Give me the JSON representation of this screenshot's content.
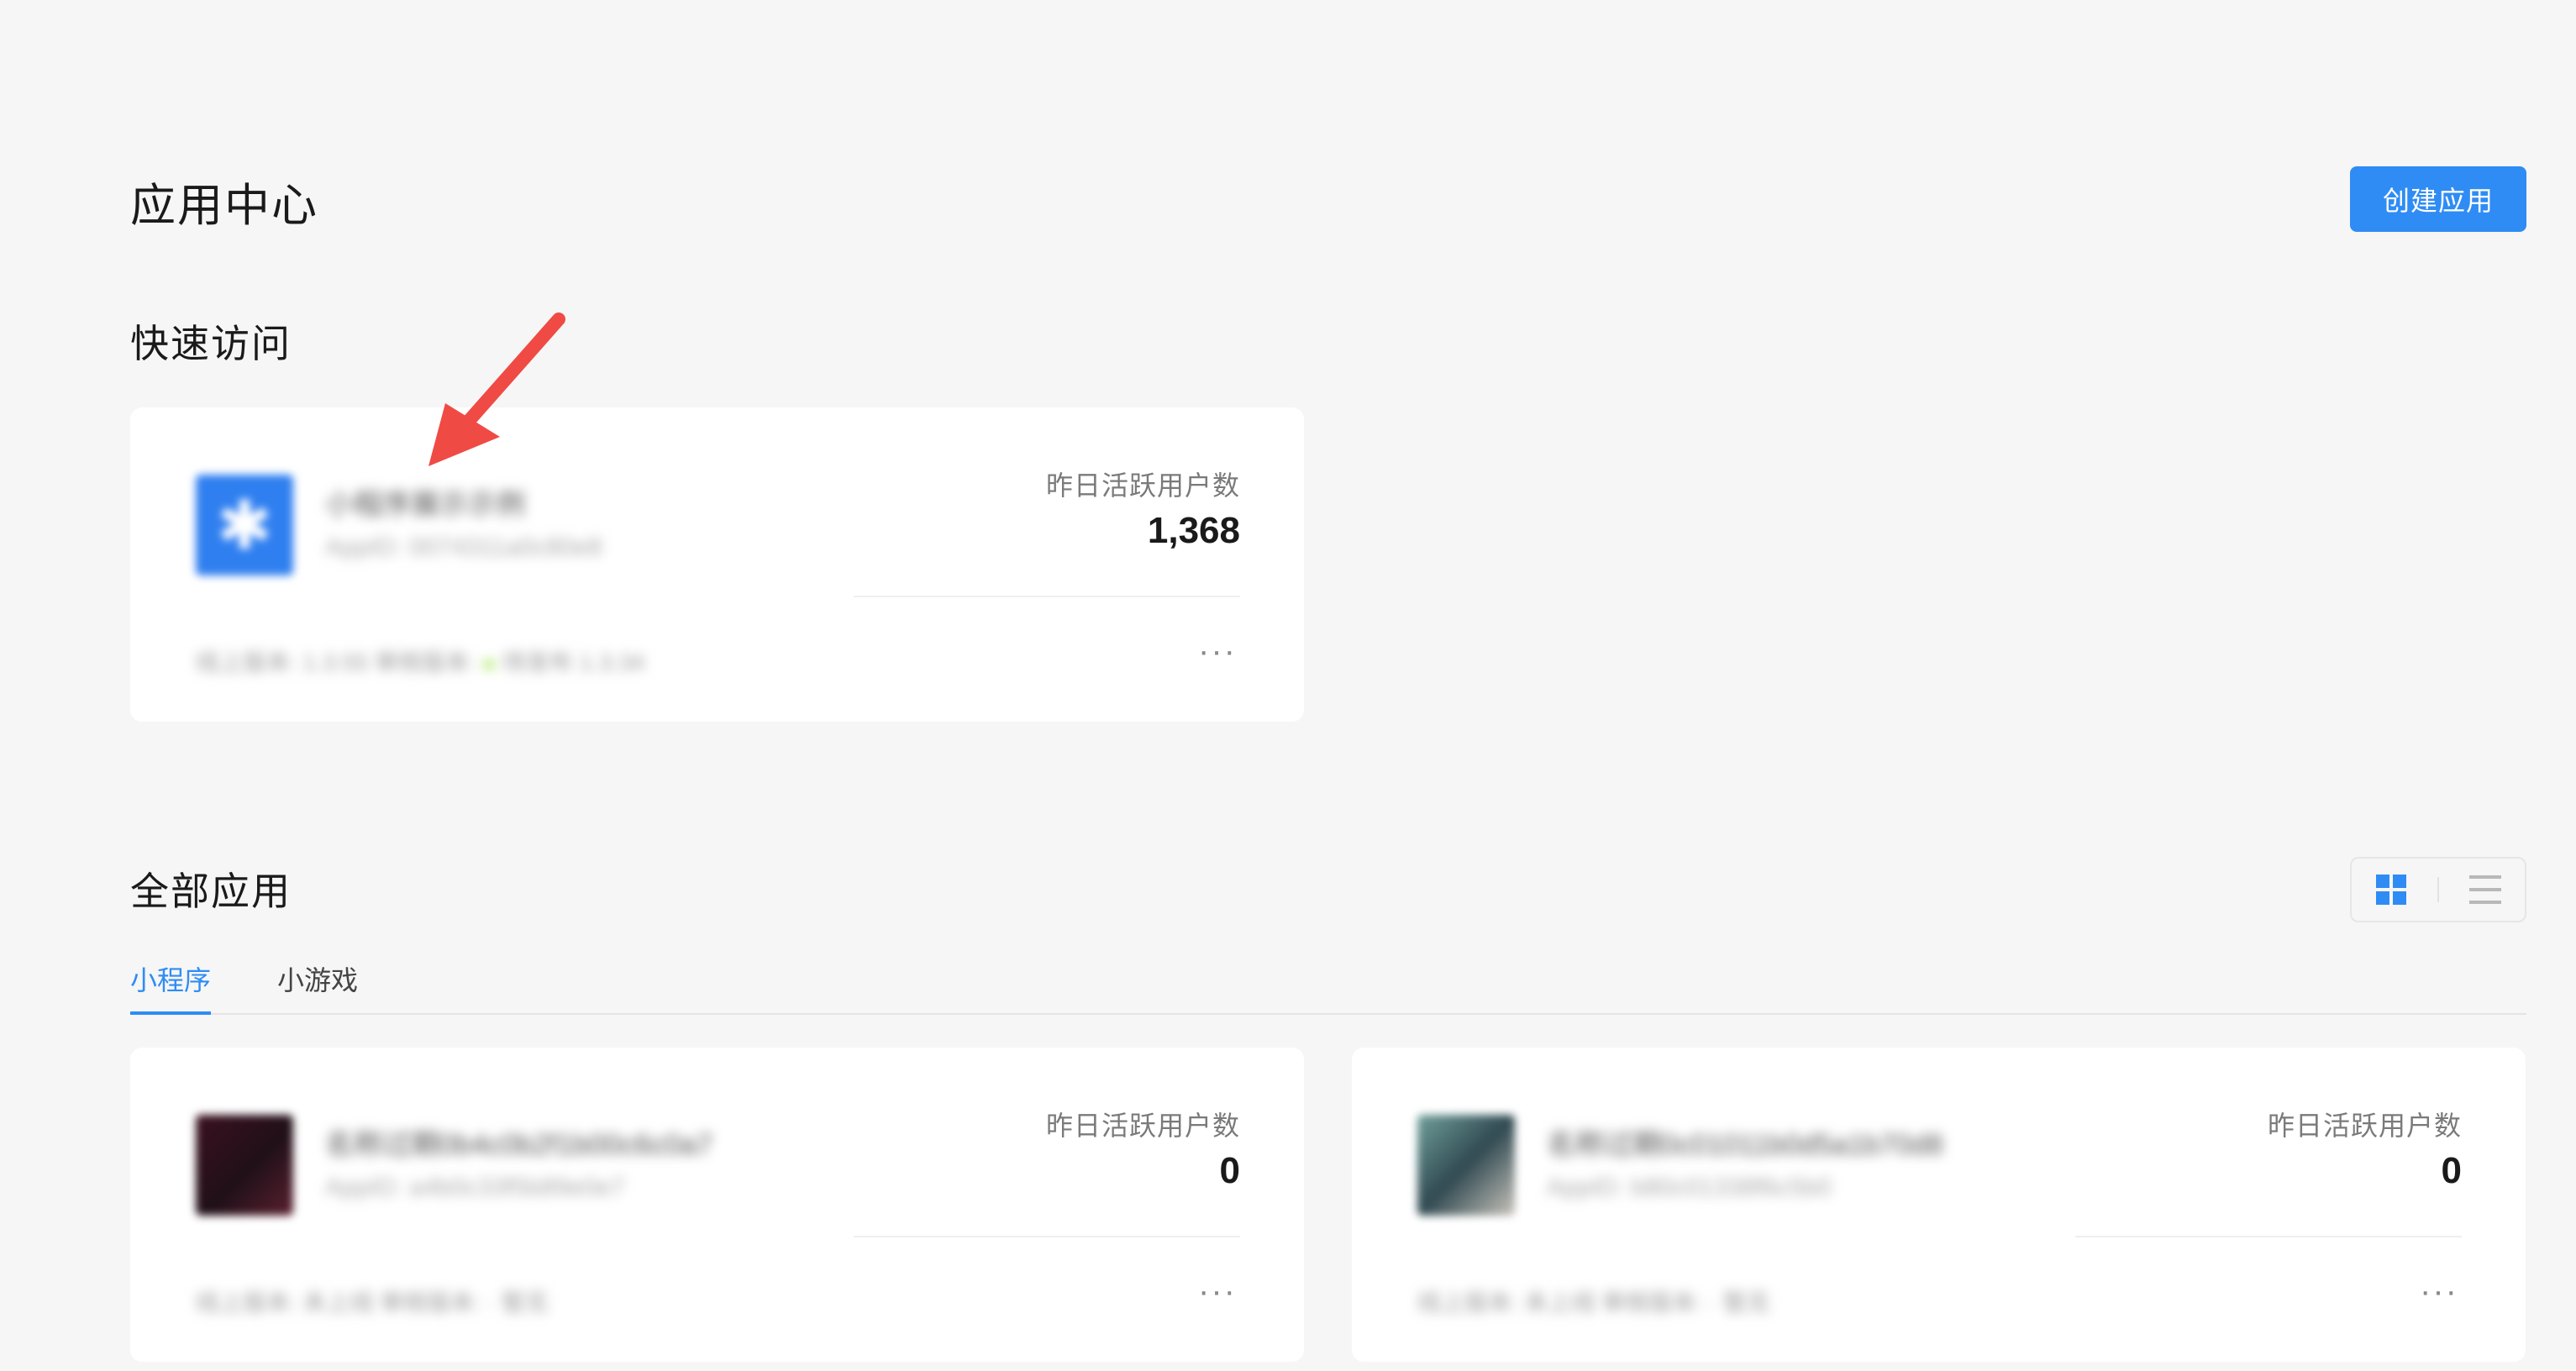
{
  "header": {
    "title": "应用中心",
    "create_button": "创建应用"
  },
  "quick_access": {
    "title": "快速访问",
    "card": {
      "name": "小程序展示示例",
      "appid": "AppID: 0074311a0c80e8",
      "dau_label": "昨日活跃用户数",
      "dau_value": "1,368",
      "meta_left": "线上版本: 1.3.55  审核版本:",
      "meta_right": "待发布 1.3.34",
      "more": "···"
    }
  },
  "all_apps": {
    "title": "全部应用",
    "tabs": [
      "小程序",
      "小游戏"
    ],
    "view_toggle": {
      "grid_icon": "grid-icon",
      "list_icon": "list-icon",
      "active": "grid"
    },
    "cards": [
      {
        "name": "名称过期0b4c0b2f1b00c6c0a7",
        "appid": "AppID: a4b0c33f5b89e0e7",
        "dau_label": "昨日活跃用户数",
        "dau_value": "0",
        "meta": "线上版本: 未上线  审核版本: · 暂无",
        "more": "···"
      },
      {
        "name": "名称过期0c01011b0d5a1b70d8",
        "appid": "AppID: b80c01338f6c5b0",
        "dau_label": "昨日活跃用户数",
        "dau_value": "0",
        "meta": "线上版本: 未上线  审核版本: · 暂无",
        "more": "···"
      }
    ]
  },
  "colors": {
    "accent": "#2f8cf4",
    "annotation_arrow": "#f04a45"
  }
}
